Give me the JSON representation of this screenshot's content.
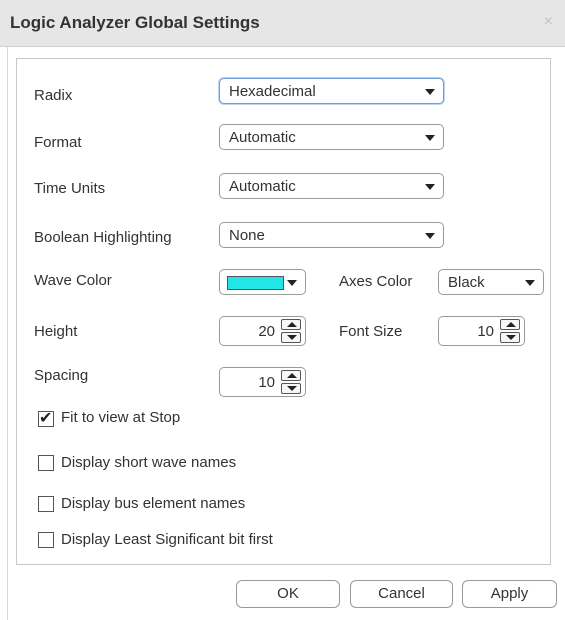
{
  "window": {
    "title": "Logic Analyzer Global Settings",
    "close_glyph": "×"
  },
  "radix": {
    "label": "Radix",
    "value": "Hexadecimal"
  },
  "format": {
    "label": "Format",
    "value": "Automatic"
  },
  "time_units": {
    "label": "Time Units",
    "value": "Automatic"
  },
  "boolean_highlighting": {
    "label": "Boolean Highlighting",
    "value": "None"
  },
  "wave_color": {
    "label": "Wave Color",
    "color": "#22e6e6"
  },
  "axes_color": {
    "label": "Axes Color",
    "value": "Black"
  },
  "height": {
    "label": "Height",
    "value": "20"
  },
  "font_size": {
    "label": "Font Size",
    "value": "10"
  },
  "spacing": {
    "label": "Spacing",
    "value": "10"
  },
  "checkboxes": [
    {
      "label": "Fit to view at Stop",
      "checked": true
    },
    {
      "label": "Display short wave names",
      "checked": false
    },
    {
      "label": "Display bus element names",
      "checked": false
    },
    {
      "label": "Display Least Significant bit first",
      "checked": false
    }
  ],
  "buttons": {
    "ok": "OK",
    "cancel": "Cancel",
    "apply": "Apply"
  }
}
